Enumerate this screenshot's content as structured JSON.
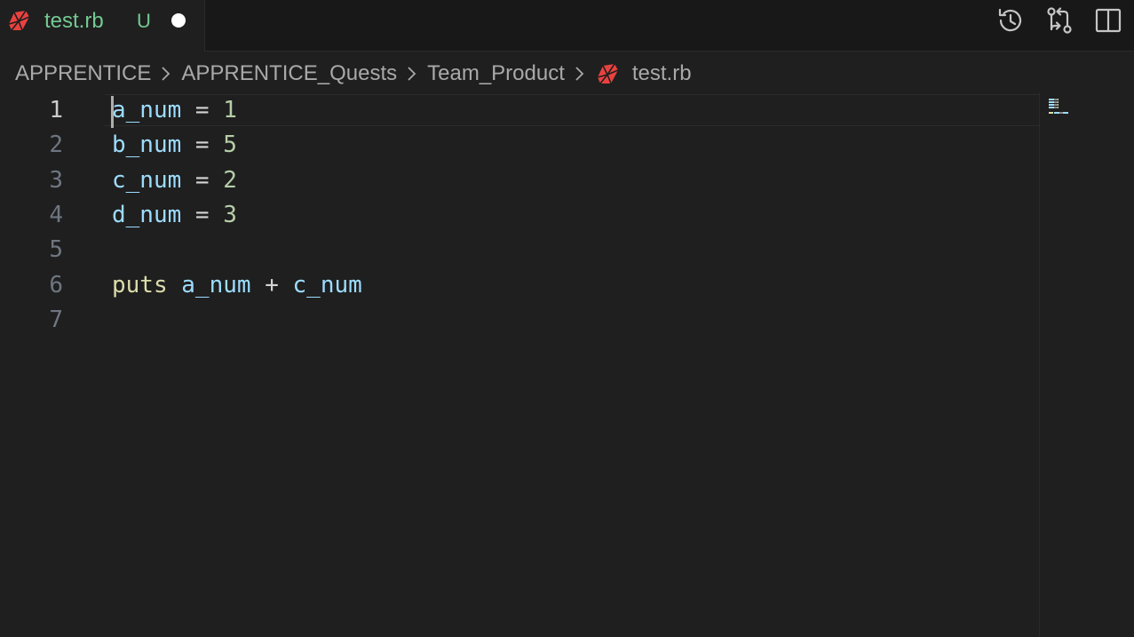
{
  "tab": {
    "filename": "test.rb",
    "status": "U",
    "icon": "ruby-icon",
    "dirty": true
  },
  "actions": [
    {
      "name": "timeline-icon"
    },
    {
      "name": "compare-changes-icon"
    },
    {
      "name": "split-editor-icon"
    }
  ],
  "breadcrumb": {
    "items": [
      "APPRENTICE",
      "APPRENTICE_Quests",
      "Team_Product"
    ],
    "file": "test.rb"
  },
  "editor": {
    "active_line": 1,
    "lines": [
      {
        "number": "1",
        "tokens": [
          [
            "var",
            "a_num"
          ],
          [
            "op",
            " = "
          ],
          [
            "num",
            "1"
          ]
        ]
      },
      {
        "number": "2",
        "tokens": [
          [
            "var",
            "b_num"
          ],
          [
            "op",
            " = "
          ],
          [
            "num",
            "5"
          ]
        ]
      },
      {
        "number": "3",
        "tokens": [
          [
            "var",
            "c_num"
          ],
          [
            "op",
            " = "
          ],
          [
            "num",
            "2"
          ]
        ]
      },
      {
        "number": "4",
        "tokens": [
          [
            "var",
            "d_num"
          ],
          [
            "op",
            " = "
          ],
          [
            "num",
            "3"
          ]
        ]
      },
      {
        "number": "5",
        "tokens": []
      },
      {
        "number": "6",
        "tokens": [
          [
            "fn",
            "puts"
          ],
          [
            "op",
            " "
          ],
          [
            "var",
            "a_num"
          ],
          [
            "op",
            " + "
          ],
          [
            "var",
            "c_num"
          ]
        ]
      },
      {
        "number": "7",
        "tokens": []
      }
    ]
  },
  "colors": {
    "accent_git_untracked": "#73c991",
    "ruby_red": "#e8423f",
    "variable": "#9cdcfe",
    "number": "#b5cea8",
    "function": "#dcdcaa"
  }
}
